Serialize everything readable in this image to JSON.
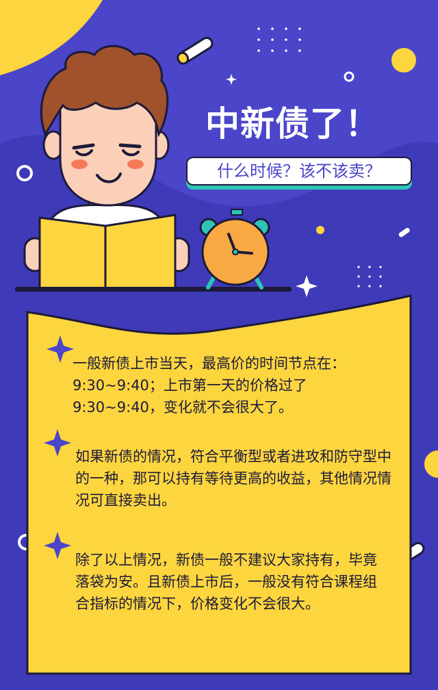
{
  "header": {
    "title": "中新债了！",
    "subtitle": "什么时候？该不该卖？"
  },
  "content": {
    "paragraphs": [
      "一般新债上市当天，最高价的时间节点在：9:30~9:40；上市第一天的价格过了9:30~9:40，变化就不会很大了。",
      "如果新债的情况，符合平衡型或者进攻和防守型中的一种，那可以持有等待更高的收益，其他情况情况可直接卖出。",
      "除了以上情况，新债一般不建议大家持有，毕竟落袋为安。且新债上市后，一般没有符合课程组合指标的情况下，价格变化不会很大。"
    ]
  },
  "colors": {
    "background": "#4a45c9",
    "accent_yellow": "#fcd53f",
    "outline": "#1d1a3a",
    "teal": "#2ec5b6",
    "hair_brown": "#a0522d",
    "clock_orange": "#f9a943"
  },
  "icons": [
    "chalk-icon",
    "sparkle-icon",
    "dot-grid-icon",
    "ring-icon",
    "alarm-clock-icon",
    "book-icon",
    "boy-illustration"
  ]
}
